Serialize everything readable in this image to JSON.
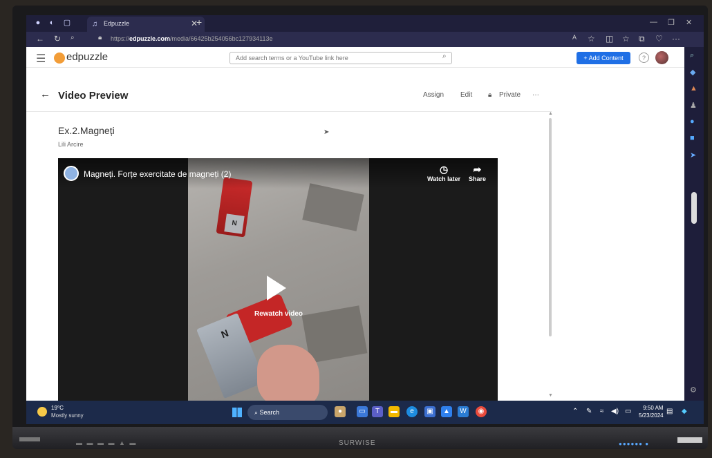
{
  "monitor": {
    "brand": "SURWISE"
  },
  "browser": {
    "tab_title": "Edpuzzle",
    "url_prefix": "https://",
    "url_domain": "edpuzzle.com",
    "url_path": "/media/66425b254056bc127934113e"
  },
  "header": {
    "logo": "edpuzzle",
    "search_placeholder": "Add search terms or a YouTube link here",
    "add_content": "+ Add Content",
    "help": "?"
  },
  "page": {
    "title": "Video Preview",
    "actions": {
      "assign": "Assign",
      "edit": "Edit",
      "private": "Private",
      "more": "···"
    },
    "video_title": "Ex.2.Magneți",
    "author": "Lili Arcire"
  },
  "video": {
    "title": "Magneți. Forțe exercitate de magneți (2)",
    "watch_later": "Watch later",
    "share": "Share",
    "rewatch": "Rewatch video",
    "magnet_top_label": "N",
    "magnet_bottom_label": "N"
  },
  "taskbar": {
    "temperature": "19°C",
    "weather": "Mostly sunny",
    "search": "Search",
    "time": "9:50 AM",
    "date": "5/23/2024"
  },
  "colors": {
    "accent": "#1f6fe5",
    "taskbar": "#1c2a4a",
    "browser_chrome": "#1f1f3a"
  }
}
